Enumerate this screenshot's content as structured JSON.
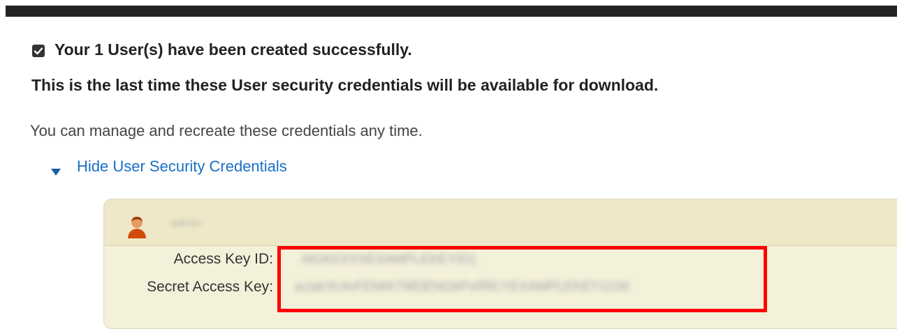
{
  "success": {
    "icon": "checkbox-checked-icon",
    "message": "Your 1 User(s) have been created successfully."
  },
  "warning": {
    "message": "This is the last time these User security credentials will be available for download."
  },
  "info": {
    "message": "You can manage and recreate these credentials any time."
  },
  "toggle": {
    "icon": "triangle-down-icon",
    "label": "Hide User Security Credentials"
  },
  "credentials": {
    "user_icon": "user-icon",
    "username": "admin",
    "access_key_id_label": "Access Key ID:",
    "access_key_id_value": "AKIAXXXXEXAMPLEKEYID1",
    "secret_access_key_label": "Secret Access Key:",
    "secret_access_key_value": "wJalrXUtnFEMIK7MDENGbPxRfiCYEXAMPLEKEY1234"
  },
  "colors": {
    "link": "#1a6ec7",
    "card_bg": "#f4f1da",
    "highlight": "#ff0000"
  }
}
